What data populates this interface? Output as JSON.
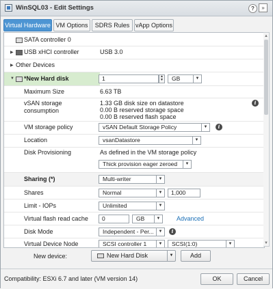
{
  "window": {
    "title": "WinSQL03 - Edit Settings",
    "help_icon": "?",
    "expand_icon": "»"
  },
  "tabs": [
    {
      "label": "Virtual Hardware",
      "active": true
    },
    {
      "label": "VM Options",
      "active": false
    },
    {
      "label": "SDRS Rules",
      "active": false
    },
    {
      "label": "vApp Options",
      "active": false
    }
  ],
  "hardware": {
    "sata": {
      "label": "SATA controller 0"
    },
    "usb": {
      "label": "USB xHCI controller",
      "value": "USB 3.0"
    },
    "other": {
      "label": "Other Devices"
    },
    "new_disk": {
      "label": "*New Hard disk",
      "size_value": "1",
      "unit": "GB"
    },
    "max_size": {
      "label": "Maximum Size",
      "value": "6.63 TB"
    },
    "vsan": {
      "label_line1": "vSAN storage",
      "label_line2": "consumption",
      "line1": "1.33 GB disk size on datastore",
      "line2": "0.00 B reserved storage space",
      "line3": "0.00 B reserved flash space"
    },
    "storage_policy": {
      "label": "VM storage policy",
      "value": "vSAN Default Storage Policy"
    },
    "location": {
      "label": "Location",
      "value": "vsanDatastore"
    },
    "provisioning": {
      "label": "Disk Provisioning",
      "note": "As defined in the VM storage policy",
      "value": "Thick provision eager zeroed"
    },
    "sharing": {
      "label": "Sharing (*)",
      "value": "Multi-writer"
    },
    "shares": {
      "label": "Shares",
      "value": "Normal",
      "amount": "1,000"
    },
    "limit": {
      "label": "Limit - IOPs",
      "value": "Unlimited"
    },
    "flash_cache": {
      "label": "Virtual flash read cache",
      "value": "0",
      "unit": "GB",
      "link": "Advanced"
    },
    "disk_mode": {
      "label": "Disk Mode",
      "value": "Independent - Per..."
    },
    "device_node": {
      "label": "Virtual Device Node",
      "controller": "SCSI controller 1",
      "slot": "SCSI(1:0)"
    }
  },
  "new_device": {
    "label": "New device:",
    "value": "New Hard Disk",
    "add_label": "Add"
  },
  "footer": {
    "compat": "Compatibility: ESXi 6.7 and later (VM version 14)",
    "ok_label": "OK",
    "cancel_label": "Cancel"
  },
  "colors": {
    "accent": "#4d95d3",
    "highlight": "#d7eccf",
    "link": "#1a6fb6"
  }
}
